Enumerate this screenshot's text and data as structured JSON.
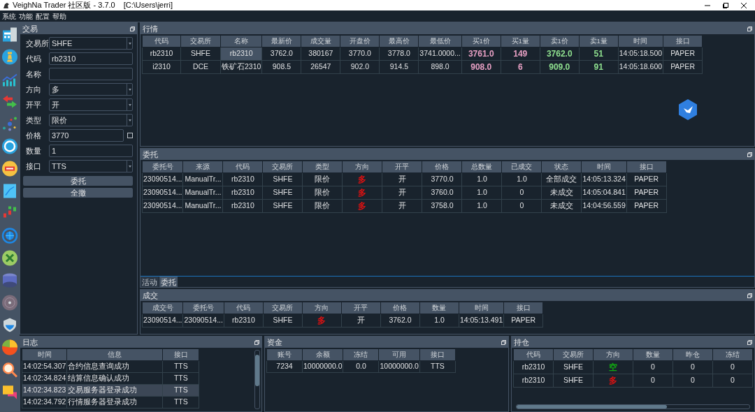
{
  "window": {
    "title": "VeighNa Trader 社区版 - 3.7.0",
    "path": "[C:\\Users\\jerri]"
  },
  "menu": [
    "系统",
    "功能",
    "配置",
    "帮助"
  ],
  "trading": {
    "title": "交易",
    "fields": [
      {
        "label": "交易所",
        "kind": "combo",
        "value": "SHFE"
      },
      {
        "label": "代码",
        "kind": "text",
        "value": "rb2310"
      },
      {
        "label": "名称",
        "kind": "text"
      },
      {
        "label": "方向",
        "kind": "combo",
        "value": "多"
      },
      {
        "label": "开平",
        "kind": "combo",
        "value": "开"
      },
      {
        "label": "类型",
        "kind": "combo",
        "value": "限价"
      },
      {
        "label": "价格",
        "kind": "text",
        "value": "3770",
        "checkbox": {
          "checked": false
        }
      },
      {
        "label": "数量",
        "kind": "text",
        "value": "1"
      },
      {
        "label": "接口",
        "kind": "combo",
        "value": "TTS"
      }
    ],
    "buttons": [
      "委托",
      "全撤"
    ]
  },
  "market": {
    "title": "行情",
    "columns": [
      "代码",
      "交易所",
      "名称",
      "最新价",
      "成交量",
      "开盘价",
      "最高价",
      "最低价",
      "买1价",
      "买1量",
      "卖1价",
      "卖1量",
      "时间",
      "接口"
    ],
    "rows": [
      {
        "cells": [
          "rb2310",
          "SHFE",
          {
            "text": "rb2310",
            "selected": true
          },
          "3762.0",
          "380167",
          "3770.0",
          "3778.0",
          "3741.0000...",
          {
            "text": "3761.0",
            "color": "#e8a0c4"
          },
          {
            "text": "149",
            "color": "#e8a0c4"
          },
          {
            "text": "3762.0",
            "color": "#8fe08f"
          },
          {
            "text": "51",
            "color": "#8fe08f"
          },
          "14:05:18.500",
          "PAPER"
        ]
      },
      {
        "cells": [
          "i2310",
          "DCE",
          {
            "text": "铁矿石2310",
            "selected": false
          },
          "908.5",
          "26547",
          "902.0",
          "914.5",
          "898.0",
          {
            "text": "908.0",
            "color": "#e8a0c4"
          },
          {
            "text": "6",
            "color": "#e8a0c4"
          },
          {
            "text": "909.0",
            "color": "#8fe08f"
          },
          {
            "text": "91",
            "color": "#8fe08f"
          },
          "14:05:18.600",
          "PAPER"
        ]
      }
    ]
  },
  "orders": {
    "title": "委托",
    "columns": [
      "委托号",
      "来源",
      "代码",
      "交易所",
      "类型",
      "方向",
      "开平",
      "价格",
      "总数量",
      "已成交",
      "状态",
      "时间",
      "接口"
    ],
    "rows": [
      {
        "cells": [
          "23090514...",
          "ManualTr...",
          "rb2310",
          "SHFE",
          "限价",
          {
            "text": "多",
            "color": "#dd1111"
          },
          "开",
          "3770.0",
          "1.0",
          "1.0",
          "全部成交",
          "14:05:13.324",
          "PAPER"
        ]
      },
      {
        "cells": [
          "23090514...",
          "ManualTr...",
          "rb2310",
          "SHFE",
          "限价",
          {
            "text": "多",
            "color": "#dd1111"
          },
          "开",
          "3760.0",
          "1.0",
          "0",
          "未成交",
          "14:05:04.841",
          "PAPER"
        ]
      },
      {
        "cells": [
          "23090514...",
          "ManualTr...",
          "rb2310",
          "SHFE",
          "限价",
          {
            "text": "多",
            "color": "#dd1111"
          },
          "开",
          "3758.0",
          "1.0",
          "0",
          "未成交",
          "14:04:56.559",
          "PAPER"
        ]
      }
    ],
    "tabs": [
      {
        "label": "活动",
        "selected": false
      },
      {
        "label": "委托",
        "selected": true
      }
    ]
  },
  "trades": {
    "title": "成交",
    "columns": [
      "成交号",
      "委托号",
      "代码",
      "交易所",
      "方向",
      "开平",
      "价格",
      "数量",
      "时间",
      "接口"
    ],
    "rows": [
      {
        "cells": [
          "23090514...",
          "23090514...",
          "rb2310",
          "SHFE",
          {
            "text": "多",
            "color": "#dd1111"
          },
          "开",
          "3762.0",
          "1.0",
          "14:05:13.491",
          "PAPER"
        ]
      }
    ]
  },
  "log": {
    "title": "日志",
    "columns": [
      "时间",
      "信息",
      "接口"
    ],
    "rows": [
      {
        "cells": [
          "14:02:54.307",
          "合约信息查询成功",
          "TTS"
        ],
        "selected": false
      },
      {
        "cells": [
          "14:02:34.824",
          "结算信息确认成功",
          "TTS"
        ],
        "selected": false
      },
      {
        "cells": [
          "14:02:34.823",
          "交易服务器登录成功",
          "TTS"
        ],
        "selected": true
      },
      {
        "cells": [
          "14:02:34.792",
          "行情服务器登录成功",
          "TTS"
        ],
        "selected": false
      }
    ]
  },
  "funds": {
    "title": "资金",
    "columns": [
      "账号",
      "余额",
      "冻结",
      "可用",
      "接口"
    ],
    "rows": [
      {
        "cells": [
          "7234",
          "10000000.0",
          "0.0",
          "10000000.0",
          "TTS"
        ]
      }
    ]
  },
  "positions": {
    "title": "持仓",
    "columns": [
      "代码",
      "交易所",
      "方向",
      "数量",
      "昨仓",
      "冻结"
    ],
    "rows": [
      {
        "cells": [
          "rb2310",
          "SHFE",
          {
            "text": "空",
            "color": "#11aa11"
          },
          "0",
          "0",
          "0"
        ]
      },
      {
        "cells": [
          "rb2310",
          "SHFE",
          {
            "text": "多",
            "color": "#dd1111"
          },
          "0",
          "0",
          "0"
        ]
      }
    ]
  }
}
